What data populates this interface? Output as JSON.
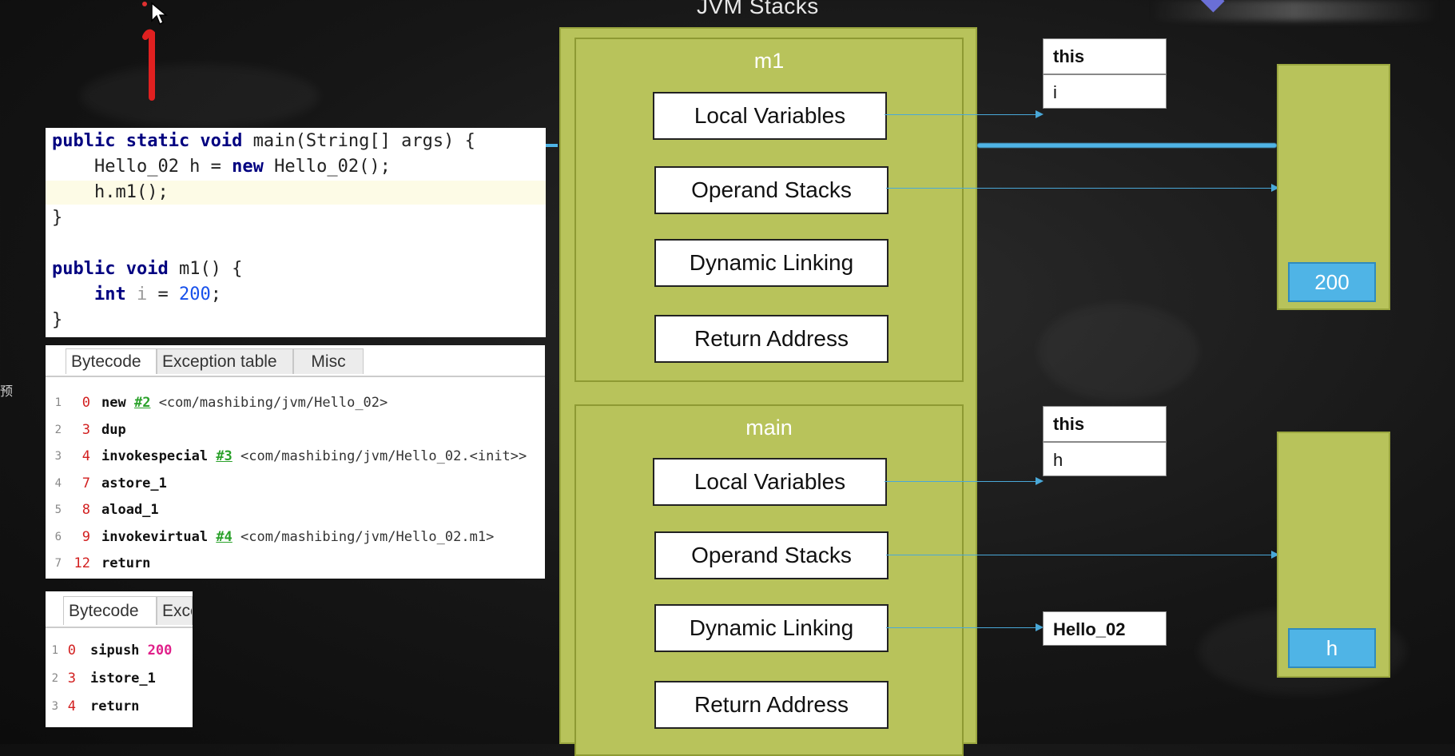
{
  "slide": {
    "title": "JVM Stacks"
  },
  "code": {
    "lines": [
      "public static void main(String[] args) {",
      "    Hello_02 h = new Hello_02();",
      "    h.m1();",
      "}",
      "",
      "public void m1() {",
      "    int i = 200;",
      "}"
    ]
  },
  "bytecode_main": {
    "tabs": [
      "Bytecode",
      "Exception table",
      "Misc"
    ],
    "rows": [
      {
        "ln": "1",
        "off": "0",
        "op": "new",
        "ref": "#2",
        "comment": "<com/mashibing/jvm/Hello_02>"
      },
      {
        "ln": "2",
        "off": "3",
        "op": "dup",
        "ref": "",
        "comment": ""
      },
      {
        "ln": "3",
        "off": "4",
        "op": "invokespecial",
        "ref": "#3",
        "comment": "<com/mashibing/jvm/Hello_02.<init>>"
      },
      {
        "ln": "4",
        "off": "7",
        "op": "astore_1",
        "ref": "",
        "comment": ""
      },
      {
        "ln": "5",
        "off": "8",
        "op": "aload_1",
        "ref": "",
        "comment": ""
      },
      {
        "ln": "6",
        "off": "9",
        "op": "invokevirtual",
        "ref": "#4",
        "comment": "<com/mashibing/jvm/Hello_02.m1>"
      },
      {
        "ln": "7",
        "off": "12",
        "op": "return",
        "ref": "",
        "comment": ""
      }
    ]
  },
  "bytecode_m1": {
    "tabs": [
      "Bytecode",
      "Exce"
    ],
    "rows": [
      {
        "ln": "1",
        "off": "0",
        "op": "sipush",
        "arg": "200"
      },
      {
        "ln": "2",
        "off": "3",
        "op": "istore_1",
        "arg": ""
      },
      {
        "ln": "3",
        "off": "4",
        "op": "return",
        "arg": ""
      }
    ]
  },
  "frames": {
    "m1": {
      "title": "m1",
      "boxes": [
        "Local Variables",
        "Operand Stacks",
        "Dynamic Linking",
        "Return Address"
      ]
    },
    "main": {
      "title": "main",
      "boxes": [
        "Local Variables",
        "Operand Stacks",
        "Dynamic Linking",
        "Return Address"
      ]
    }
  },
  "lv_tables": {
    "m1": [
      "this",
      "i"
    ],
    "main": [
      "this",
      "h"
    ]
  },
  "dynamic_link_target": "Hello_02",
  "heap": {
    "m1_value": "200",
    "main_value": "h"
  },
  "side_label": "预",
  "colors": {
    "frame_green": "#b8c35b",
    "value_blue": "#4fb4e6",
    "arrow_blue": "#49a8d8",
    "offset_red": "#d21f1f",
    "keyword_navy": "#000080"
  }
}
